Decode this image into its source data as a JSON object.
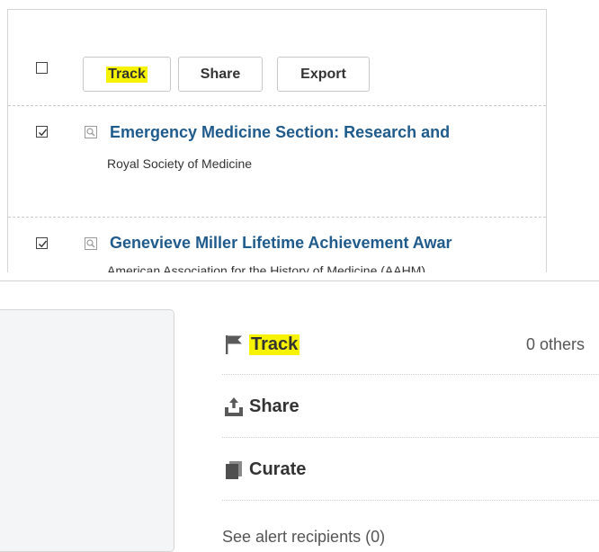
{
  "toolbar": {
    "track_label": "Track",
    "share_label": "Share",
    "export_label": "Export"
  },
  "results": [
    {
      "title": "Emergency Medicine Section: Research and",
      "subtitle": "Royal Society of Medicine",
      "checked": true
    },
    {
      "title": "Genevieve Miller Lifetime Achievement Awar",
      "subtitle": "American Association for the History of Medicine (AAHM)",
      "checked": true
    }
  ],
  "actions": {
    "track_label": "Track",
    "track_others": "0 others",
    "share_label": "Share",
    "curate_label": "Curate",
    "alert_recipients": "See alert recipients (0)"
  },
  "colors": {
    "highlight": "#f7f200",
    "link": "#1f5b8c"
  }
}
